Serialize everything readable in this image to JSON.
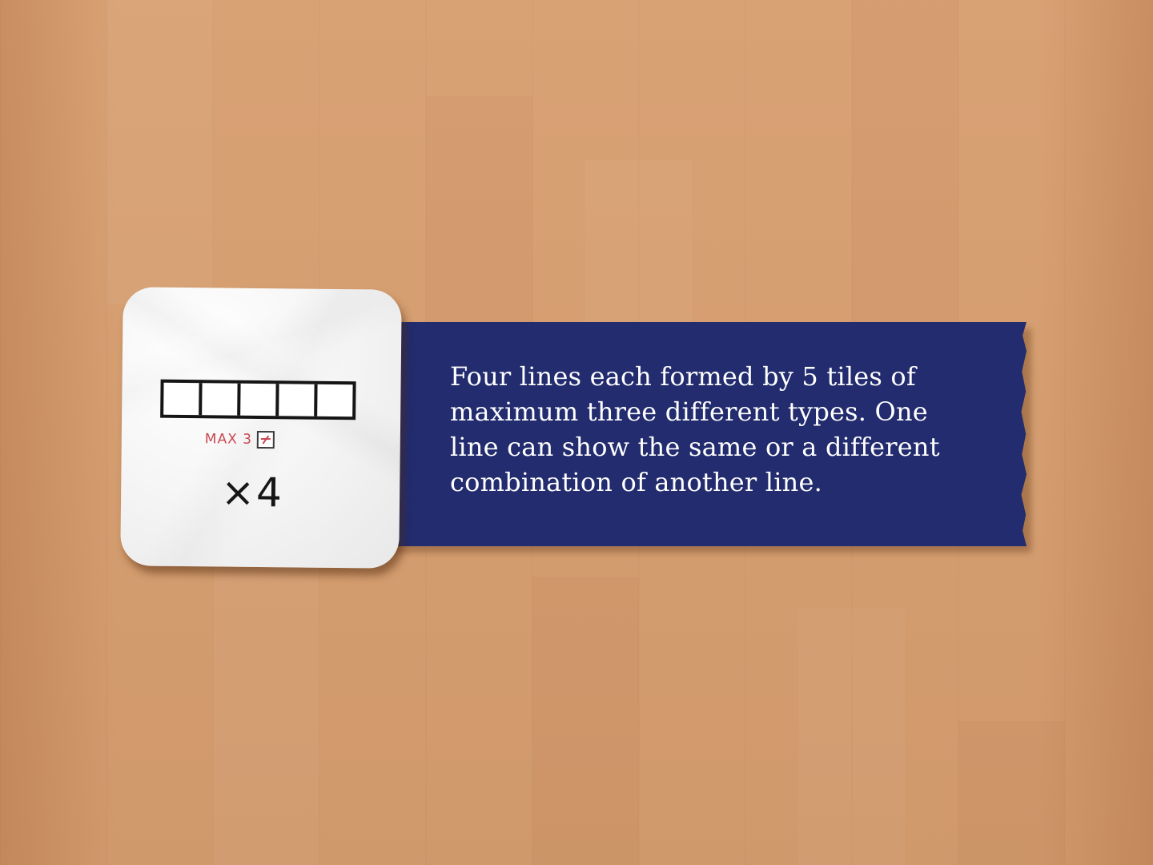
{
  "scene": {
    "background": "wood-table",
    "colors": {
      "wood": "#d79e6f",
      "banner": "#222c6e",
      "card": "#f6f6f6",
      "max_label": "#c9474f"
    }
  },
  "card": {
    "icon": "five-tile-row-icon",
    "tile_count": 5,
    "max_label": "MAX 3",
    "max_icon": "different-types-icon",
    "multiplier": "×4"
  },
  "description": {
    "text": "Four lines each formed by 5 tiles of maximum three different types. One line can show the same or a different combination of another line."
  }
}
